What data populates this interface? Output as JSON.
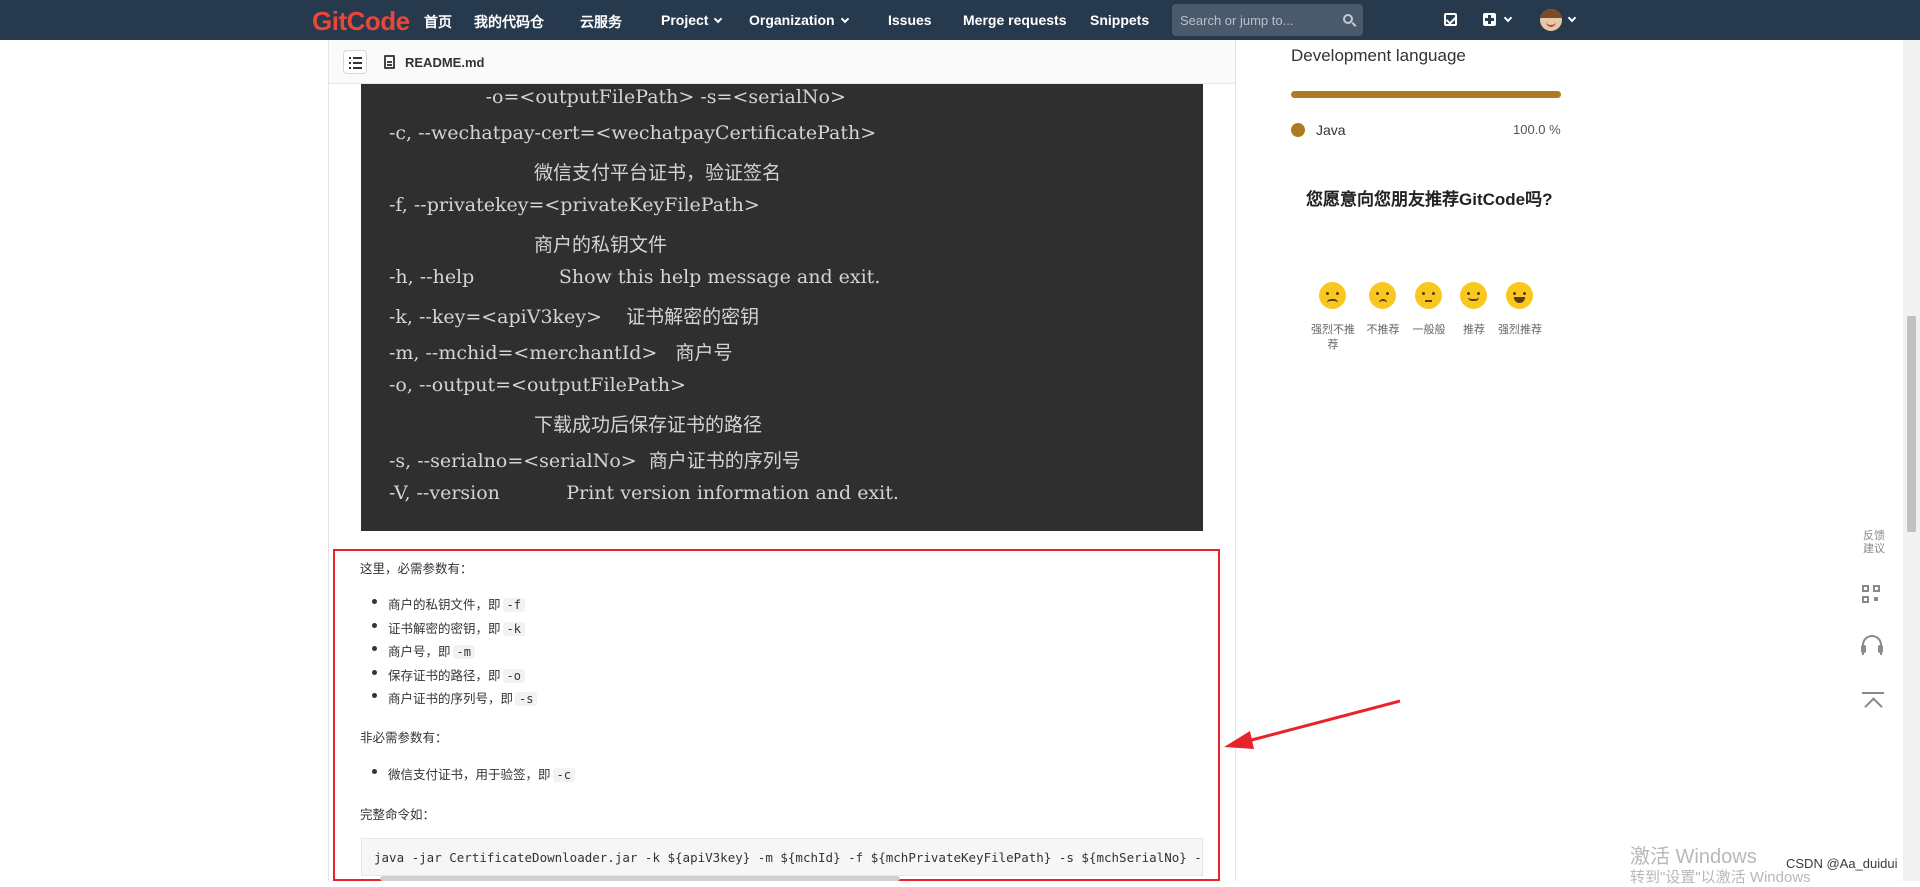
{
  "navbar": {
    "logo": "GitCode",
    "links": [
      "首页",
      "我的代码仓",
      "云服务",
      "Project",
      "Organization",
      "Issues",
      "Merge requests",
      "Snippets"
    ],
    "search_placeholder": "Search or jump to..."
  },
  "readme": {
    "filename": "README.md"
  },
  "code_block": {
    "lines": [
      "                -o=<outputFilePath> -s=<serialNo>",
      "-c, --wechatpay-cert=<wechatpayCertificatePath>",
      "                        微信支付平台证书，验证签名",
      "-f, --privatekey=<privateKeyFilePath>",
      "                        商户的私钥文件",
      "-h, --help              Show this help message and exit.",
      "-k, --key=<apiV3key>    证书解密的密钥",
      "-m, --mchid=<merchantId>   商户号",
      "-o, --output=<outputFilePath>",
      "                        下载成功后保存证书的路径",
      "-s, --serialno=<serialNo>  商户证书的序列号",
      "-V, --version           Print version information and exit."
    ]
  },
  "content": {
    "required_heading": "这里，必需参数有：",
    "required_items": [
      {
        "text": "商户的私钥文件，即",
        "code": "-f"
      },
      {
        "text": "证书解密的密钥，即",
        "code": "-k"
      },
      {
        "text": "商户号，即",
        "code": "-m"
      },
      {
        "text": "保存证书的路径，即",
        "code": "-o"
      },
      {
        "text": "商户证书的序列号，即",
        "code": "-s"
      }
    ],
    "optional_heading": "非必需参数有：",
    "optional_items": [
      {
        "text": "微信支付证书，用于验签，即",
        "code": "-c"
      }
    ],
    "full_cmd_heading": "完整命令如：",
    "full_cmd": "java -jar CertificateDownloader.jar -k ${apiV3key} -m ${mchId} -f ${mchPrivateKeyFilePath} -s ${mchSerialNo} -o ${outputFilePath}"
  },
  "sidebar": {
    "lang_title": "Development language",
    "lang_name": "Java",
    "lang_pct": "100.0 %",
    "lang_fraction": 1.0,
    "recommend_title": "您愿意向您朋友推荐GitCode吗?",
    "ratings": [
      "强烈不推荐",
      "不推荐",
      "一般般",
      "推荐",
      "强烈推荐"
    ]
  },
  "float_tools": {
    "feedback": "反馈建议"
  },
  "colors": {
    "nav_bg": "#27394d",
    "java": "#b07a22",
    "highlight_red": "#e8232a",
    "code_bg": "#2f2f2f"
  },
  "watermark": {
    "line1": "激活 Windows",
    "line2": "转到\"设置\"以激活 Windows",
    "csdn": "CSDN @Aa_duidui"
  }
}
